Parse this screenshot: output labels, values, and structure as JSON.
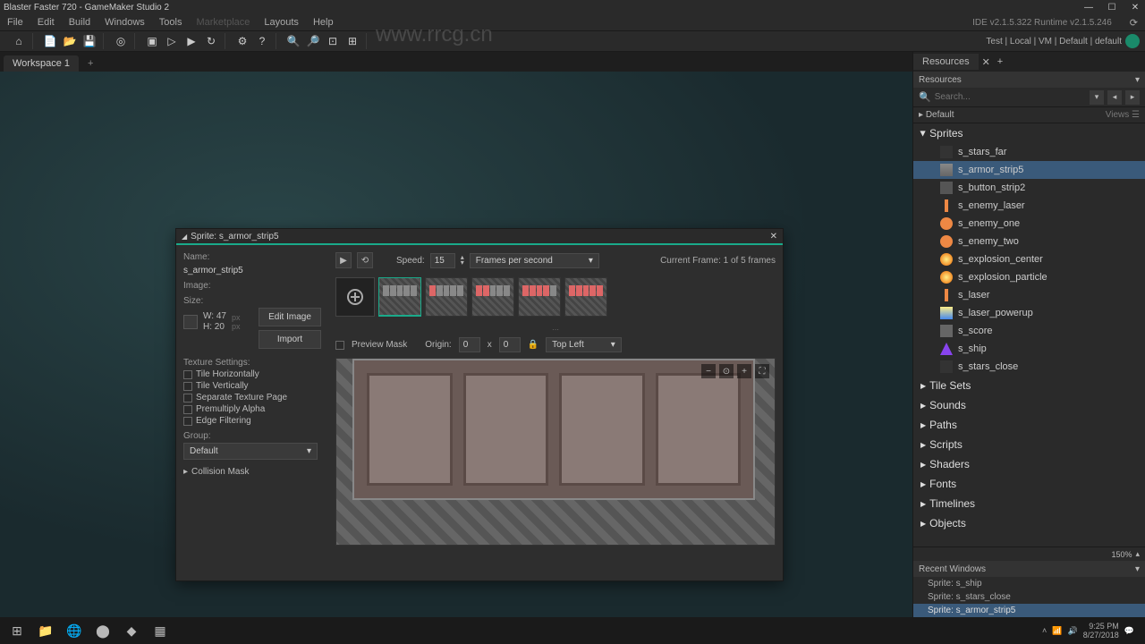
{
  "window": {
    "title": "Blaster Faster 720 - GameMaker Studio 2",
    "ide_version": "IDE v2.1.5.322 Runtime v2.1.5.246"
  },
  "menu": {
    "file": "File",
    "edit": "Edit",
    "build": "Build",
    "windows": "Windows",
    "tools": "Tools",
    "marketplace": "Marketplace",
    "layouts": "Layouts",
    "help": "Help"
  },
  "toolbar_right": "Test | Local | VM | Default | default",
  "workspace_tab": "Workspace 1",
  "sprite_editor": {
    "title": "Sprite: s_armor_strip5",
    "name_label": "Name:",
    "name_value": "s_armor_strip5",
    "image_label": "Image:",
    "size_label": "Size:",
    "width": "W: 47",
    "height": "H: 20",
    "px": "px",
    "edit_image": "Edit Image",
    "import": "Import",
    "texture_settings": "Texture Settings:",
    "tile_h": "Tile Horizontally",
    "tile_v": "Tile Vertically",
    "sep_page": "Separate Texture Page",
    "premult": "Premultiply Alpha",
    "edge_filter": "Edge Filtering",
    "group_label": "Group:",
    "group_value": "Default",
    "collision": "Collision Mask",
    "speed_label": "Speed:",
    "speed_value": "15",
    "fps": "Frames per second",
    "current_frame": "Current Frame: 1 of 5 frames",
    "preview_mask": "Preview Mask",
    "origin_label": "Origin:",
    "origin_x": "0",
    "origin_y": "0",
    "origin_anchor": "Top Left"
  },
  "resources": {
    "panel_title": "Resources",
    "header": "Resources",
    "search_placeholder": "Search...",
    "default": "Default",
    "views": "Views",
    "sections": {
      "sprites": "Sprites",
      "tilesets": "Tile Sets",
      "sounds": "Sounds",
      "paths": "Paths",
      "scripts": "Scripts",
      "shaders": "Shaders",
      "fonts": "Fonts",
      "timelines": "Timelines",
      "objects": "Objects"
    },
    "sprites": [
      "s_stars_far",
      "s_armor_strip5",
      "s_button_strip2",
      "s_enemy_laser",
      "s_enemy_one",
      "s_enemy_two",
      "s_explosion_center",
      "s_explosion_particle",
      "s_laser",
      "s_laser_powerup",
      "s_score",
      "s_ship",
      "s_stars_close"
    ],
    "zoom": "150%"
  },
  "recent": {
    "title": "Recent Windows",
    "items": [
      "Sprite: s_ship",
      "Sprite: s_stars_close",
      "Sprite: s_armor_strip5"
    ]
  },
  "taskbar": {
    "time": "9:25 PM",
    "date": "8/27/2018"
  },
  "watermark_url": "www.rrcg.cn"
}
